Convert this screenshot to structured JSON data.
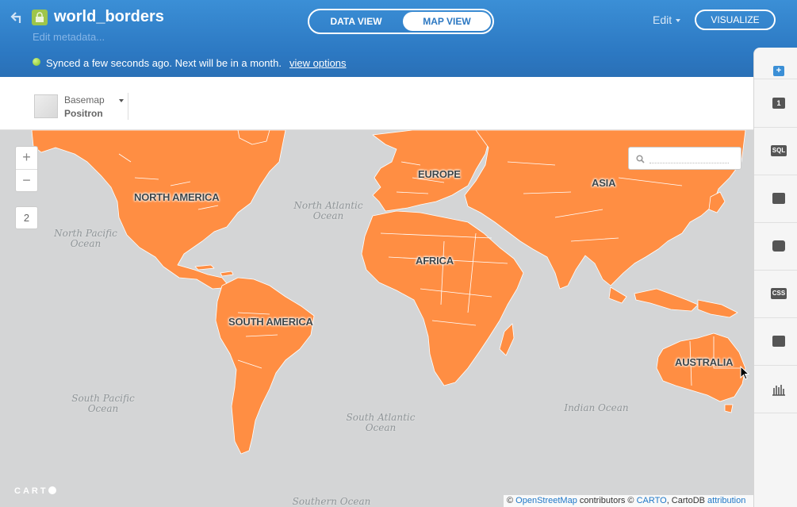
{
  "header": {
    "title": "world_borders",
    "edit_metadata": "Edit metadata...",
    "sync_status": "Synced a few seconds ago. Next will be in a month.",
    "view_options": "view options",
    "tabs": {
      "data_view": "DATA VIEW",
      "map_view": "MAP VIEW"
    },
    "edit_menu": "Edit",
    "visualize_button": "VISUALIZE"
  },
  "toolbar": {
    "basemap_label": "Basemap",
    "basemap_value": "Positron"
  },
  "map": {
    "zoom_in": "+",
    "zoom_out": "−",
    "zoom_level": "2",
    "search_placeholder": "",
    "continents": {
      "north_america": "NORTH AMERICA",
      "south_america": "SOUTH AMERICA",
      "europe": "EUROPE",
      "africa": "AFRICA",
      "asia": "ASIA",
      "australia": "AUSTRALIA"
    },
    "oceans": {
      "north_atlantic_1": "North Atlantic",
      "north_atlantic_2": "Ocean",
      "north_pacific_1": "North Pacific",
      "north_pacific_2": "Ocean",
      "south_pacific_1": "South Pacific",
      "south_pacific_2": "Ocean",
      "south_atlantic_1": "South Atlantic",
      "south_atlantic_2": "Ocean",
      "indian": "Indian Ocean",
      "southern": "Southern Ocean"
    },
    "logo": "CART",
    "attribution": {
      "prefix": "© ",
      "osm": "OpenStreetMap",
      "mid": " contributors © ",
      "carto": "CARTO",
      "mid2": ", CartoDB ",
      "attr": "attribution"
    },
    "fill_color": "#ff8e43"
  },
  "sidebar": {
    "items": [
      {
        "icon": "add-layer-icon",
        "label": "+"
      },
      {
        "icon": "layer-number-icon",
        "label": "1"
      },
      {
        "icon": "sql-icon",
        "label": "SQL"
      },
      {
        "icon": "wizard-icon",
        "label": ""
      },
      {
        "icon": "infowindow-icon",
        "label": ""
      },
      {
        "icon": "css-icon",
        "label": "CSS"
      },
      {
        "icon": "legend-icon",
        "label": ""
      },
      {
        "icon": "filters-icon",
        "label": ""
      }
    ]
  }
}
